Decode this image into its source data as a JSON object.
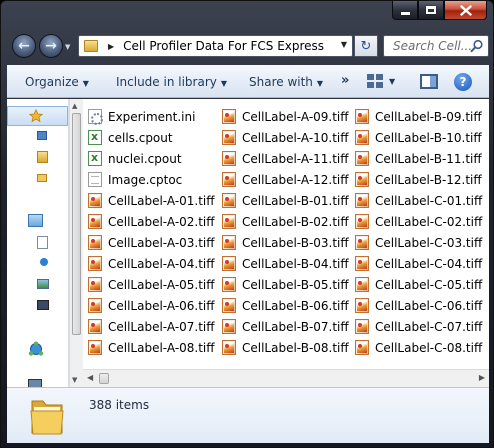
{
  "address": {
    "folder_name": "Cell Profiler Data For FCS Express"
  },
  "search": {
    "placeholder": "Search Cell..."
  },
  "toolbar": {
    "organize": "Organize",
    "include_in_library": "Include in library",
    "share_with": "Share with",
    "more": "»",
    "help": "?"
  },
  "files": {
    "columns": [
      [
        {
          "name": "Experiment.ini",
          "icon": "settings-file-icon"
        },
        {
          "name": "cells.cpout",
          "icon": "excel-file-icon"
        },
        {
          "name": "nuclei.cpout",
          "icon": "excel-file-icon"
        },
        {
          "name": "Image.cptoc",
          "icon": "document-file-icon"
        },
        {
          "name": "CellLabel-A-01.tiff",
          "icon": "tiff-image-icon"
        },
        {
          "name": "CellLabel-A-02.tiff",
          "icon": "tiff-image-icon"
        },
        {
          "name": "CellLabel-A-03.tiff",
          "icon": "tiff-image-icon"
        },
        {
          "name": "CellLabel-A-04.tiff",
          "icon": "tiff-image-icon"
        },
        {
          "name": "CellLabel-A-05.tiff",
          "icon": "tiff-image-icon"
        },
        {
          "name": "CellLabel-A-06.tiff",
          "icon": "tiff-image-icon"
        },
        {
          "name": "CellLabel-A-07.tiff",
          "icon": "tiff-image-icon"
        },
        {
          "name": "CellLabel-A-08.tiff",
          "icon": "tiff-image-icon"
        }
      ],
      [
        {
          "name": "CellLabel-A-09.tiff",
          "icon": "tiff-image-icon"
        },
        {
          "name": "CellLabel-A-10.tiff",
          "icon": "tiff-image-icon"
        },
        {
          "name": "CellLabel-A-11.tiff",
          "icon": "tiff-image-icon"
        },
        {
          "name": "CellLabel-A-12.tiff",
          "icon": "tiff-image-icon"
        },
        {
          "name": "CellLabel-B-01.tiff",
          "icon": "tiff-image-icon"
        },
        {
          "name": "CellLabel-B-02.tiff",
          "icon": "tiff-image-icon"
        },
        {
          "name": "CellLabel-B-03.tiff",
          "icon": "tiff-image-icon"
        },
        {
          "name": "CellLabel-B-04.tiff",
          "icon": "tiff-image-icon"
        },
        {
          "name": "CellLabel-B-05.tiff",
          "icon": "tiff-image-icon"
        },
        {
          "name": "CellLabel-B-06.tiff",
          "icon": "tiff-image-icon"
        },
        {
          "name": "CellLabel-B-07.tiff",
          "icon": "tiff-image-icon"
        },
        {
          "name": "CellLabel-B-08.tiff",
          "icon": "tiff-image-icon"
        }
      ],
      [
        {
          "name": "CellLabel-B-09.tiff",
          "icon": "tiff-image-icon"
        },
        {
          "name": "CellLabel-B-10.tiff",
          "icon": "tiff-image-icon"
        },
        {
          "name": "CellLabel-B-11.tiff",
          "icon": "tiff-image-icon"
        },
        {
          "name": "CellLabel-B-12.tiff",
          "icon": "tiff-image-icon"
        },
        {
          "name": "CellLabel-C-01.tiff",
          "icon": "tiff-image-icon"
        },
        {
          "name": "CellLabel-C-02.tiff",
          "icon": "tiff-image-icon"
        },
        {
          "name": "CellLabel-C-03.tiff",
          "icon": "tiff-image-icon"
        },
        {
          "name": "CellLabel-C-04.tiff",
          "icon": "tiff-image-icon"
        },
        {
          "name": "CellLabel-C-05.tiff",
          "icon": "tiff-image-icon"
        },
        {
          "name": "CellLabel-C-06.tiff",
          "icon": "tiff-image-icon"
        },
        {
          "name": "CellLabel-C-07.tiff",
          "icon": "tiff-image-icon"
        },
        {
          "name": "CellLabel-C-08.tiff",
          "icon": "tiff-image-icon"
        }
      ]
    ]
  },
  "details": {
    "item_count": "388 items"
  },
  "nav_icons": [
    "favorites-star-icon",
    "desktop-icon",
    "downloads-icon",
    "libraries-icon",
    "documents-icon",
    "music-icon",
    "pictures-icon",
    "videos-icon",
    "network-icon",
    "computer-icon"
  ],
  "colors": {
    "accent": "#1e395b",
    "titlebar": "#1f232c",
    "close_button": "#c7503c"
  }
}
